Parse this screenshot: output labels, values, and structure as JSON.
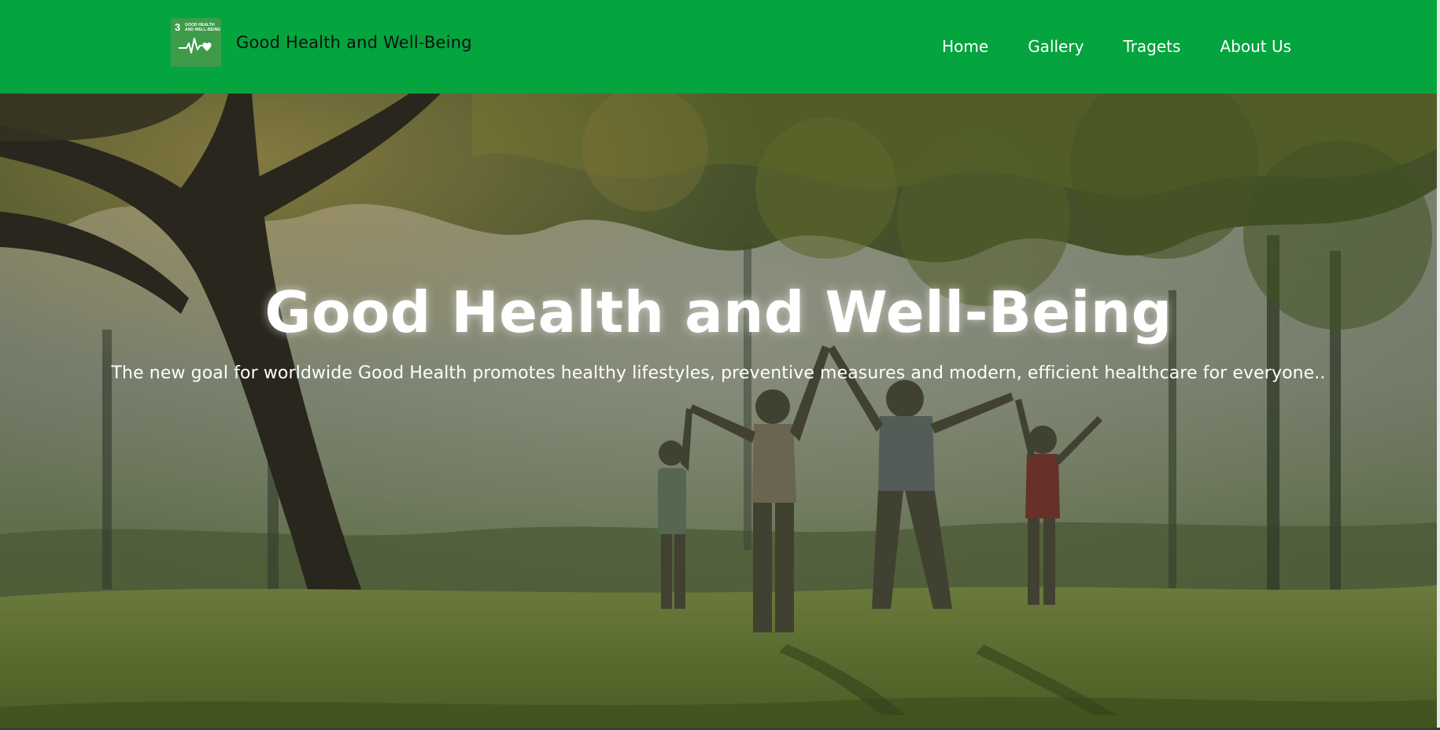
{
  "header": {
    "logo": {
      "number": "3",
      "title_line1": "GOOD HEALTH",
      "title_line2": "AND WELL-BEING",
      "icon": "heartbeat-heart-icon"
    },
    "brand_name": "Good Health and Well-Being",
    "nav": [
      {
        "label": "Home"
      },
      {
        "label": "Gallery"
      },
      {
        "label": "Tragets"
      },
      {
        "label": "About Us"
      }
    ]
  },
  "hero": {
    "title": "Good Health and Well-Being",
    "subtitle": "The new goal for worldwide Good Health promotes healthy lifestyles, preventive measures and modern, efficient healthcare for everyone..",
    "image": "family-jumping-in-park-photo"
  },
  "colors": {
    "navbar": "#04a43e",
    "logo_tile": "#3d9b4a",
    "nav_text": "#ffffff",
    "brand_text": "#111111",
    "hero_text": "#ffffff"
  }
}
